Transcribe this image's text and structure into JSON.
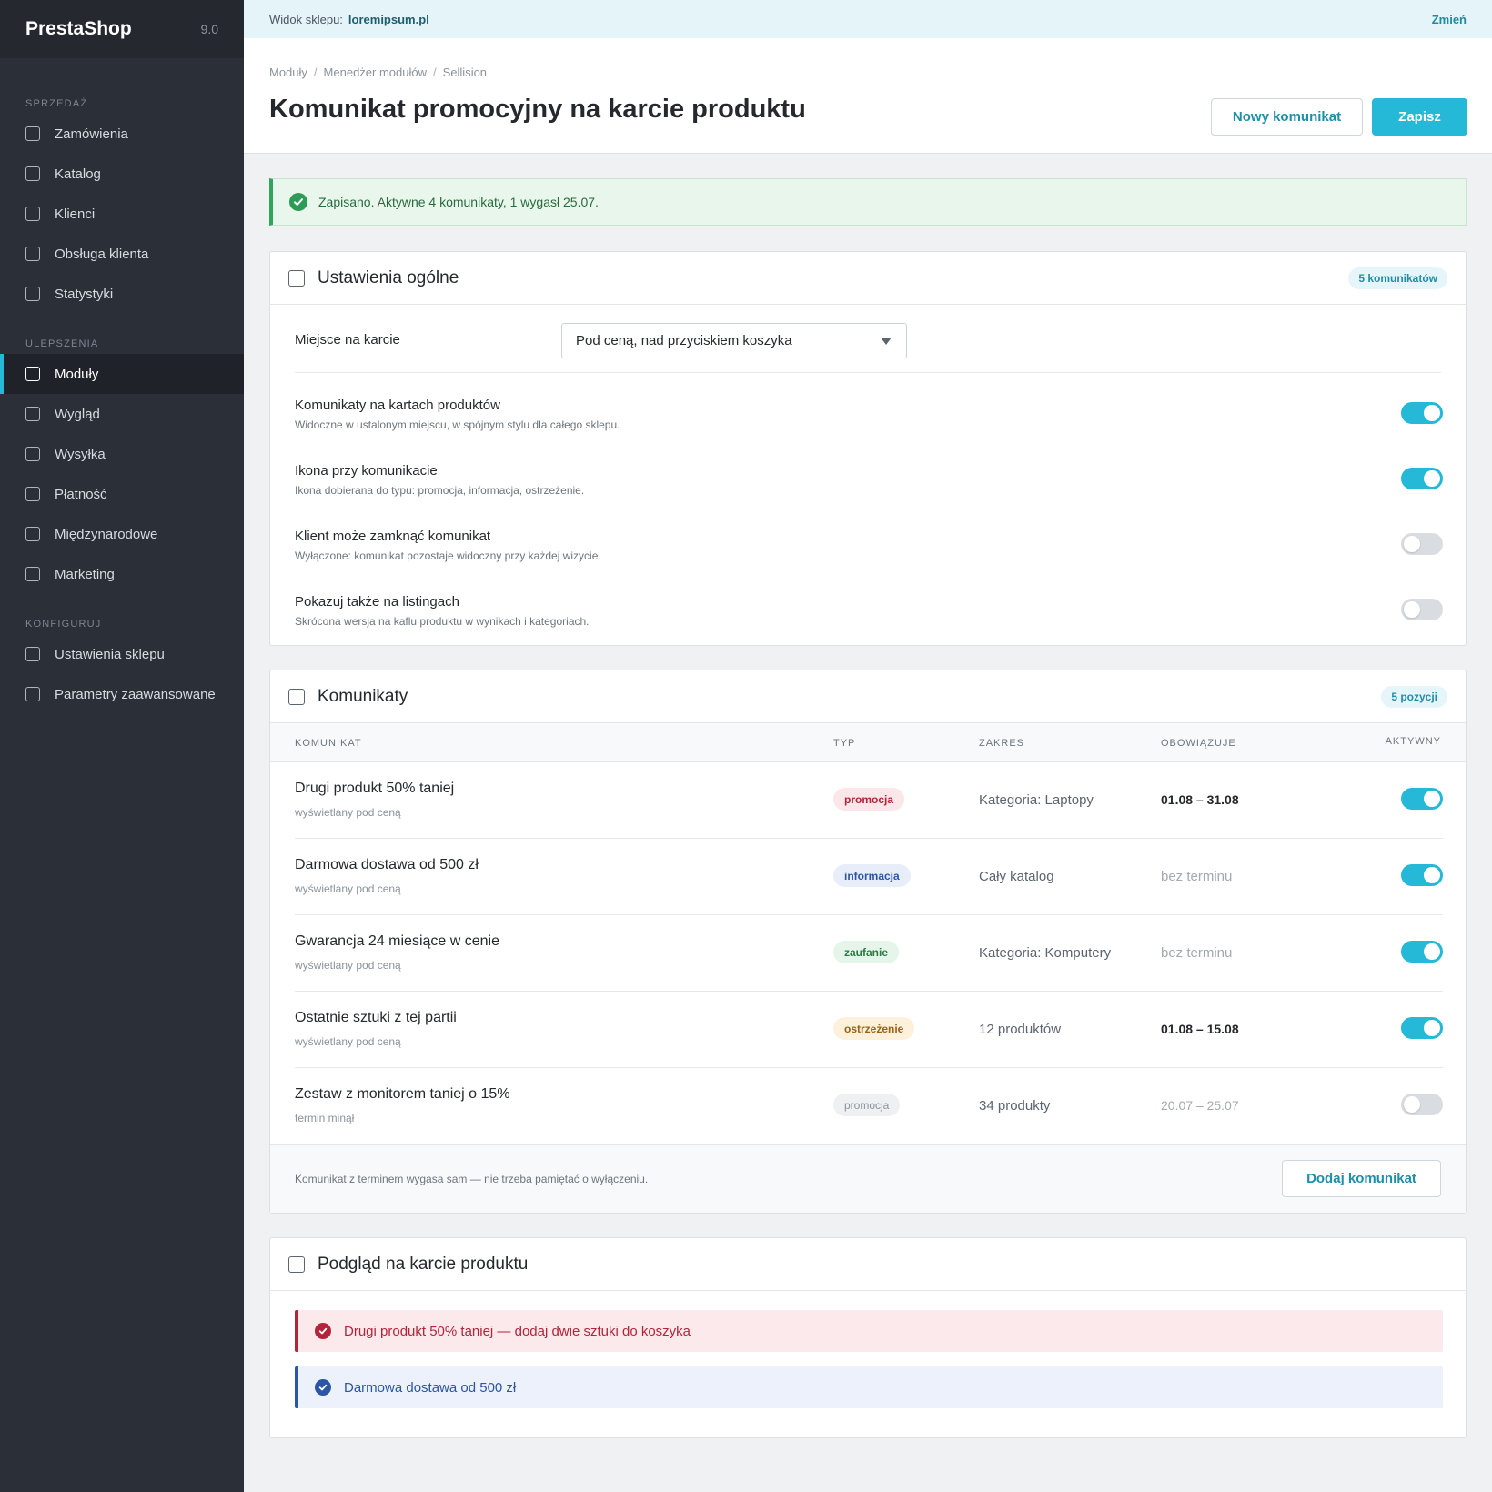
{
  "app": {
    "name": "PrestaShop",
    "version": "9.0"
  },
  "sidebar": {
    "sections": [
      {
        "title": "SPRZEDAŻ",
        "items": [
          "Zamówienia",
          "Katalog",
          "Klienci",
          "Obsługa klienta",
          "Statystyki"
        ]
      },
      {
        "title": "ULEPSZENIA",
        "items": [
          "Moduły",
          "Wygląd",
          "Wysyłka",
          "Płatność",
          "Międzynarodowe",
          "Marketing"
        ]
      },
      {
        "title": "KONFIGURUJ",
        "items": [
          "Ustawienia sklepu",
          "Parametry zaawansowane"
        ]
      }
    ],
    "active": "Moduły"
  },
  "topbar": {
    "label": "Widok sklepu:",
    "shop": "loremipsum.pl",
    "change": "Zmień"
  },
  "breadcrumb": [
    "Moduły",
    "Menedżer modułów",
    "Sellision"
  ],
  "page_title": "Komunikat promocyjny na karcie produktu",
  "actions": {
    "new": "Nowy komunikat",
    "save": "Zapisz"
  },
  "alert": "Zapisano. Aktywne 4 komunikaty, 1 wygasł 25.07.",
  "general": {
    "title": "Ustawienia ogólne",
    "badge": "5 komunikatów",
    "placement_label": "Miejsce na karcie",
    "placement_value": "Pod ceną, nad przyciskiem koszyka",
    "settings": [
      {
        "title": "Komunikaty na kartach produktów",
        "desc": "Widoczne w ustalonym miejscu, w spójnym stylu dla całego sklepu.",
        "on": true
      },
      {
        "title": "Ikona przy komunikacie",
        "desc": "Ikona dobierana do typu: promocja, informacja, ostrzeżenie.",
        "on": true
      },
      {
        "title": "Klient może zamknąć komunikat",
        "desc": "Wyłączone: komunikat pozostaje widoczny przy każdej wizycie.",
        "on": false
      },
      {
        "title": "Pokazuj także na listingach",
        "desc": "Skrócona wersja na kaflu produktu w wynikach i kategoriach.",
        "on": false
      }
    ]
  },
  "messages": {
    "title": "Komunikaty",
    "badge": "5 pozycji",
    "columns": {
      "message": "KOMUNIKAT",
      "type": "TYP",
      "scope": "ZAKRES",
      "valid": "OBOWIĄZUJE",
      "active": "AKTYWNY"
    },
    "rows": [
      {
        "name": "Drugi produkt 50% taniej",
        "sub": "wyświetlany pod ceną",
        "type": "promocja",
        "type_style": "promo",
        "scope": "Kategoria: Laptopy",
        "valid": "01.08 – 31.08",
        "valid_muted": false,
        "active": true
      },
      {
        "name": "Darmowa dostawa od 500 zł",
        "sub": "wyświetlany pod ceną",
        "type": "informacja",
        "type_style": "info",
        "scope": "Cały katalog",
        "valid": "bez terminu",
        "valid_muted": true,
        "active": true
      },
      {
        "name": "Gwarancja 24 miesiące w cenie",
        "sub": "wyświetlany pod ceną",
        "type": "zaufanie",
        "type_style": "trust",
        "scope": "Kategoria: Komputery",
        "valid": "bez terminu",
        "valid_muted": true,
        "active": true
      },
      {
        "name": "Ostatnie sztuki z tej partii",
        "sub": "wyświetlany pod ceną",
        "type": "ostrzeżenie",
        "type_style": "warn",
        "scope": "12 produktów",
        "valid": "01.08 – 15.08",
        "valid_muted": false,
        "active": true
      },
      {
        "name": "Zestaw z monitorem taniej o 15%",
        "sub": "termin minął",
        "type": "promocja",
        "type_style": "mute",
        "scope": "34 produkty",
        "valid": "20.07 – 25.07",
        "valid_muted": true,
        "active": false
      }
    ],
    "footer_note": "Komunikat z terminem wygasa sam — nie trzeba pamiętać o wyłączeniu.",
    "add_button": "Dodaj komunikat"
  },
  "preview": {
    "title": "Podgląd na karcie produktu",
    "items": [
      {
        "text": "Drugi produkt 50% taniej — dodaj dwie sztuki do koszyka",
        "style": "red"
      },
      {
        "text": "Darmowa dostawa od 500 zł",
        "style": "blue"
      }
    ]
  },
  "colors": {
    "accent": "#25b9d7",
    "sidebar": "#2b2f38",
    "success": "#2d9b57",
    "danger": "#b3243a",
    "info": "#2a56a5"
  }
}
